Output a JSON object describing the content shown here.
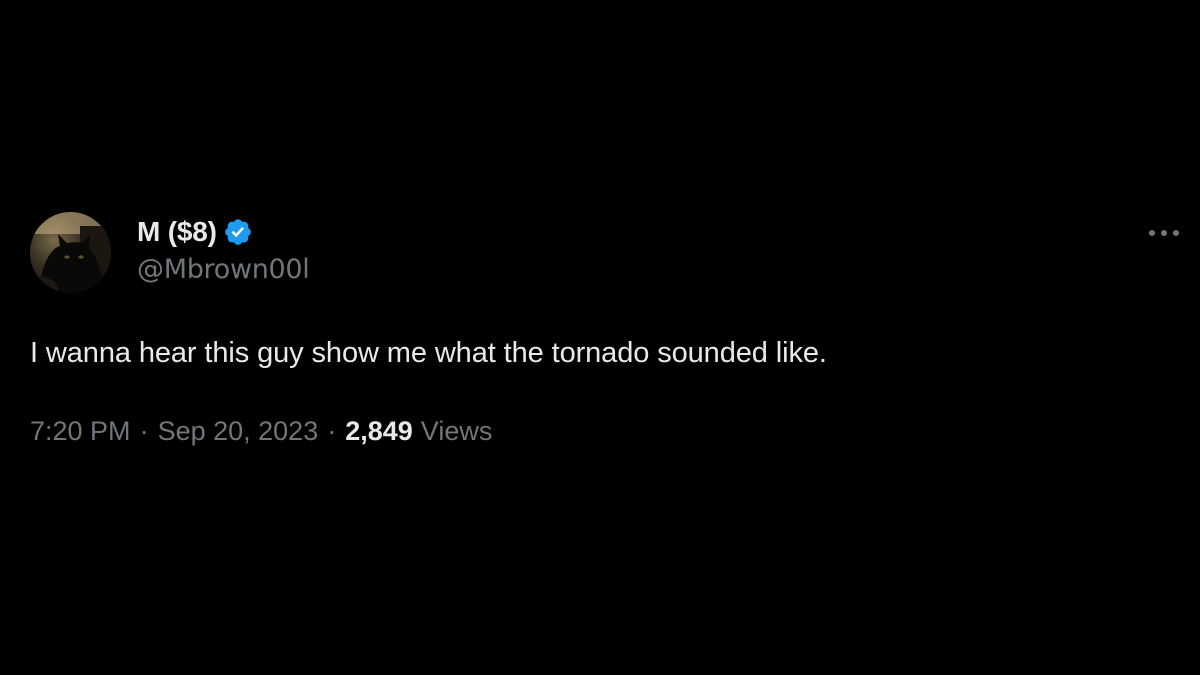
{
  "tweet": {
    "author": {
      "display_name": "M ($8)",
      "handle": "@Mbrown00l",
      "verified": true,
      "avatar_icon": "black-cat-avatar"
    },
    "text": "I wanna hear this guy show me what the tornado sounded like.",
    "time": "7:20 PM",
    "separator": "·",
    "date": "Sep 20, 2023",
    "views_count": "2,849",
    "views_label": "Views",
    "more_icon": "more-dots-icon"
  },
  "colors": {
    "background": "#000000",
    "primary_text": "#e7e9ea",
    "secondary_text": "#71767b",
    "verified_badge": "#1d9bf0"
  }
}
